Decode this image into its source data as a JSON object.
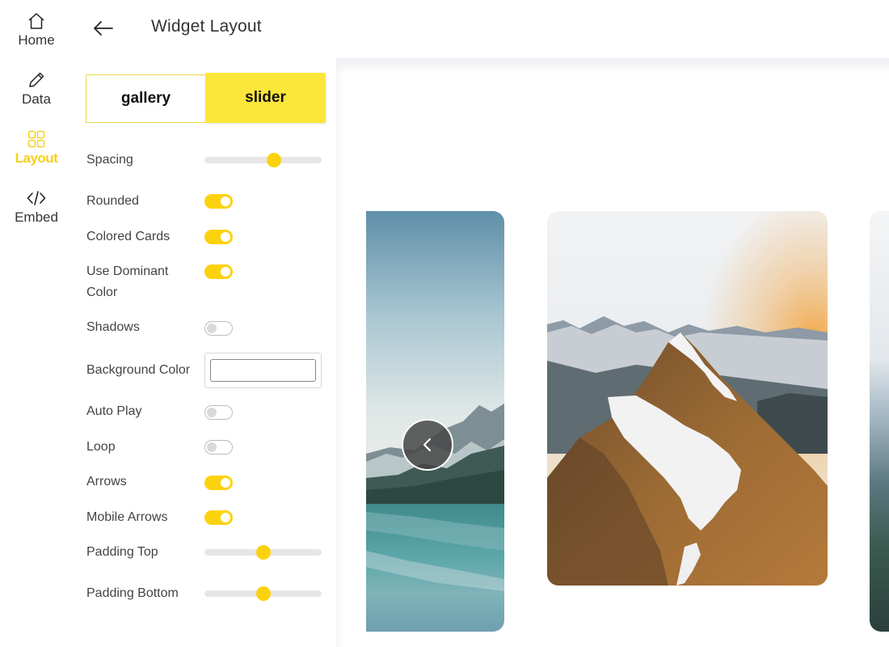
{
  "nav": {
    "items": [
      {
        "label": "Home",
        "icon": "home-icon",
        "active": false
      },
      {
        "label": "Data",
        "icon": "pencil-icon",
        "active": false
      },
      {
        "label": "Layout",
        "icon": "grid-icon",
        "active": true
      },
      {
        "label": "Embed",
        "icon": "code-icon",
        "active": false
      }
    ]
  },
  "header": {
    "back_icon": "arrow-left-icon",
    "title": "Widget Layout"
  },
  "layout_type": {
    "options": [
      "gallery",
      "slider"
    ],
    "selected": "slider"
  },
  "settings": {
    "spacing": {
      "label": "Spacing",
      "value": 0.59
    },
    "rounded": {
      "label": "Rounded",
      "on": true
    },
    "colored_cards": {
      "label": "Colored Cards",
      "on": true
    },
    "use_dominant_color": {
      "label": "Use Dominant Color",
      "on": true
    },
    "shadows": {
      "label": "Shadows",
      "on": false
    },
    "background_color": {
      "label": "Background Color",
      "value": ""
    },
    "auto_play": {
      "label": "Auto Play",
      "on": false
    },
    "loop": {
      "label": "Loop",
      "on": false
    },
    "arrows": {
      "label": "Arrows",
      "on": true
    },
    "mobile_arrows": {
      "label": "Mobile Arrows",
      "on": true
    },
    "padding_top": {
      "label": "Padding Top",
      "value": 0.5
    },
    "padding_bottom": {
      "label": "Padding Bottom",
      "value": 0.5
    }
  },
  "preview": {
    "prev_arrow_icon": "chevron-left-icon",
    "cards": [
      "lake-mountain-photo",
      "snowy-ridge-photo",
      "valley-photo"
    ]
  },
  "colors": {
    "accent": "#fcd20f",
    "segment_active": "#fde63a",
    "toggle_off_knob": "#d9d9d9"
  }
}
